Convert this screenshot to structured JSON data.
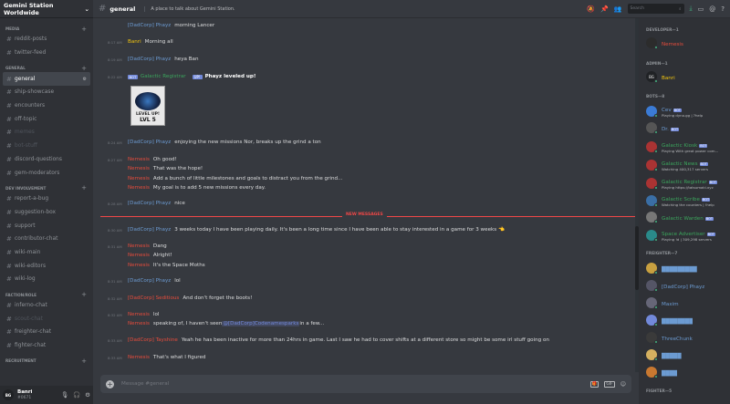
{
  "server": {
    "name": "Gemini Station Worldwide"
  },
  "categories": {
    "media": "MEDIA",
    "general": "GENERAL",
    "dev": "DEV INVOLVEMENT",
    "faction": "FACTION/ROLE",
    "recruitment": "RECRUITMENT"
  },
  "channels": {
    "reddit_posts": "reddit-posts",
    "twitter_feed": "twitter-feed",
    "general": "general",
    "ship_showcase": "ship-showcase",
    "encounters": "encounters",
    "off_topic": "off-topic",
    "memes": "memes",
    "bot_stuff": "bot-stuff",
    "discord_questions": "discord-questions",
    "gem_moderators": "gem-moderators",
    "report_a_bug": "report-a-bug",
    "suggestion_box": "suggestion-box",
    "support": "support",
    "contributor_chat": "contributor-chat",
    "wiki_main": "wiki-main",
    "wiki_editors": "wiki-editors",
    "wiki_log": "wiki-log",
    "inferno_chat": "inferno-chat",
    "scout_chat": "scout-chat",
    "freighter_chat": "freighter-chat",
    "fighter_chat": "fighter-chat"
  },
  "user": {
    "name": "Banri",
    "tag": "#0671",
    "avatar_text": "BG"
  },
  "header": {
    "channel": "general",
    "topic": "A place to talk about Gemini Station.",
    "search_placeholder": "Search"
  },
  "messages": [
    {
      "time": "",
      "author": "[DadCorp] Phayz",
      "text": "morning Lancer"
    },
    {
      "time": "8:17 AM",
      "author": "Banri",
      "text": "Morning all"
    },
    {
      "time": "8:19 AM",
      "author": "[DadCorp] Phayz",
      "text": "heya Ban"
    },
    {
      "time": "8:22 AM",
      "bot": "BOT",
      "author": "Galactic Registrar",
      "up": "UP!",
      "text": "Phayz leveled up!"
    },
    {
      "time": "8:24 AM",
      "author": "[DadCorp] Phayz",
      "text": "enjoying the new missions Nor, breaks up the grind a ton"
    },
    {
      "time": "8:27 AM",
      "author": "Nemesis",
      "text": "Oh good!"
    },
    {
      "time": "",
      "author": "Nemesis",
      "text": "That was the hope!"
    },
    {
      "time": "",
      "author": "Nemesis",
      "text": "Add a bunch of little milestones and goals to distract you from the grind..."
    },
    {
      "time": "",
      "author": "Nemesis",
      "text": "My goal is to add 5 new missions every day."
    },
    {
      "time": "8:28 AM",
      "author": "[DadCorp] Phayz",
      "text": "nice"
    },
    {
      "time": "8:30 AM",
      "author": "[DadCorp] Phayz",
      "text": "3 weeks today I have been playing daily. It's been a long time since I have been able to stay interested in a game for 3 weeks 👈"
    },
    {
      "time": "8:31 AM",
      "author": "Nemesis",
      "text": "Dang"
    },
    {
      "time": "",
      "author": "Nemesis",
      "text": "Alright!"
    },
    {
      "time": "",
      "author": "Nemesis",
      "text": "It's the Space Moths"
    },
    {
      "time": "8:31 AM",
      "author": "[DadCorp] Phayz",
      "text": "lol"
    },
    {
      "time": "8:32 AM",
      "author": "[DadCorp] Seditious",
      "text": "And don't forget the boots!"
    },
    {
      "time": "8:32 AM",
      "author": "Nemesis",
      "text": "lol"
    },
    {
      "time": "",
      "author": "Nemesis",
      "text_before": "speaking of, I haven't seen ",
      "mention": "@[DadCorp]Codenamesparks",
      "text": " in a few..."
    },
    {
      "time": "8:33 AM",
      "author": "[DadCorp] Tayshine",
      "text": "Yeah he has been inactive for more than 24hrs in game.  Last I saw he had to cover shifts at a different store so might be some irl stuff going on"
    },
    {
      "time": "8:33 AM",
      "author": "Nemesis",
      "text": "That's what I figured"
    }
  ],
  "level_image": {
    "line1": "LEVEL UP!",
    "line2": "LVL 5"
  },
  "new_messages_label": "NEW MESSAGES",
  "composer": {
    "placeholder": "Message #general"
  },
  "member_groups": {
    "developer": "DEVELOPER—1",
    "admin": "ADMIN—1",
    "bots": "BOTS—8",
    "freighter": "FREIGHTER—7",
    "fighter": "FIGHTER—5"
  },
  "members": {
    "dev1": {
      "name": "Nemesis"
    },
    "admin1": {
      "name": "Banri"
    },
    "bot1": {
      "name": "Cev",
      "activity": "Playing dyno.gg | ?help"
    },
    "bot2": {
      "name": "Dr.",
      "activity": ""
    },
    "bot3": {
      "name": "Galactic Kiosk",
      "activity": "Playing With great power com..."
    },
    "bot4": {
      "name": "Galactic News",
      "activity": "Watching 400,317 servers"
    },
    "bot5": {
      "name": "Galactic Registrar",
      "activity": "Playing https://tatsumaki.xyz"
    },
    "bot6": {
      "name": "Galactic Scribe",
      "activity": "Watching the counters | !help"
    },
    "bot7": {
      "name": "Galactic Warden",
      "activity": ""
    },
    "bot8": {
      "name": "Space Advertiser",
      "activity": "Playing !d | 309,298 servers"
    },
    "f1": {
      "name": "[DadCorp] Phayz"
    },
    "f2": {
      "name": "Maxim"
    },
    "f3": {
      "name": "ThreeChunk"
    }
  },
  "bot_tag": "BOT",
  "colors": {
    "accent": "#7289da",
    "online": "#43b581",
    "danger": "#f04747"
  }
}
